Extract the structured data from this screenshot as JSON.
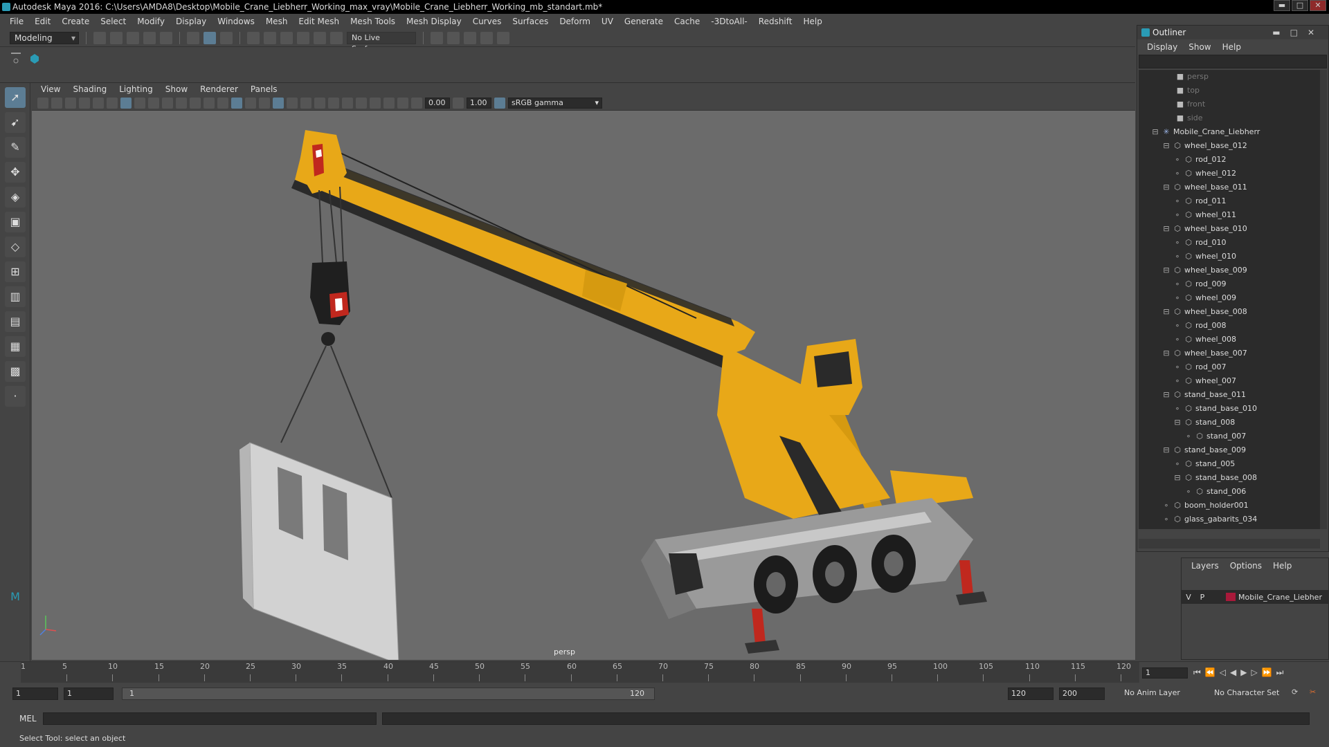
{
  "window": {
    "title": "Autodesk Maya 2016: C:\\Users\\AMDA8\\Desktop\\Mobile_Crane_Liebherr_Working_max_vray\\Mobile_Crane_Liebherr_Working_mb_standart.mb*",
    "min": "▬",
    "max": "□",
    "close": "✕"
  },
  "menu": [
    "File",
    "Edit",
    "Create",
    "Select",
    "Modify",
    "Display",
    "Windows",
    "Mesh",
    "Edit Mesh",
    "Mesh Tools",
    "Mesh Display",
    "Curves",
    "Surfaces",
    "Deform",
    "UV",
    "Generate",
    "Cache",
    "-3DtoAll-",
    "Redshift",
    "Help"
  ],
  "shelf": {
    "mode": "Modeling",
    "live_surface": "No Live Surface"
  },
  "viewport": {
    "menu": [
      "View",
      "Shading",
      "Lighting",
      "Show",
      "Renderer",
      "Panels"
    ],
    "exposure": "0.00",
    "gamma_value": "1.00",
    "color_space": "sRGB gamma",
    "camera_label": "persp"
  },
  "outliner": {
    "title": "Outliner",
    "menu": [
      "Display",
      "Show",
      "Help"
    ],
    "items": [
      {
        "name": "persp",
        "depth": 0,
        "type": "camera"
      },
      {
        "name": "top",
        "depth": 0,
        "type": "camera"
      },
      {
        "name": "front",
        "depth": 0,
        "type": "camera"
      },
      {
        "name": "side",
        "depth": 0,
        "type": "camera"
      },
      {
        "name": "Mobile_Crane_Liebherr",
        "depth": 0,
        "type": "group",
        "expanded": true
      },
      {
        "name": "wheel_base_012",
        "depth": 1,
        "type": "mesh",
        "expanded": true
      },
      {
        "name": "rod_012",
        "depth": 2,
        "type": "mesh"
      },
      {
        "name": "wheel_012",
        "depth": 2,
        "type": "mesh"
      },
      {
        "name": "wheel_base_011",
        "depth": 1,
        "type": "mesh",
        "expanded": true
      },
      {
        "name": "rod_011",
        "depth": 2,
        "type": "mesh"
      },
      {
        "name": "wheel_011",
        "depth": 2,
        "type": "mesh"
      },
      {
        "name": "wheel_base_010",
        "depth": 1,
        "type": "mesh",
        "expanded": true
      },
      {
        "name": "rod_010",
        "depth": 2,
        "type": "mesh"
      },
      {
        "name": "wheel_010",
        "depth": 2,
        "type": "mesh"
      },
      {
        "name": "wheel_base_009",
        "depth": 1,
        "type": "mesh",
        "expanded": true
      },
      {
        "name": "rod_009",
        "depth": 2,
        "type": "mesh"
      },
      {
        "name": "wheel_009",
        "depth": 2,
        "type": "mesh"
      },
      {
        "name": "wheel_base_008",
        "depth": 1,
        "type": "mesh",
        "expanded": true
      },
      {
        "name": "rod_008",
        "depth": 2,
        "type": "mesh"
      },
      {
        "name": "wheel_008",
        "depth": 2,
        "type": "mesh"
      },
      {
        "name": "wheel_base_007",
        "depth": 1,
        "type": "mesh",
        "expanded": true
      },
      {
        "name": "rod_007",
        "depth": 2,
        "type": "mesh"
      },
      {
        "name": "wheel_007",
        "depth": 2,
        "type": "mesh"
      },
      {
        "name": "stand_base_011",
        "depth": 1,
        "type": "mesh",
        "expanded": true
      },
      {
        "name": "stand_base_010",
        "depth": 2,
        "type": "mesh"
      },
      {
        "name": "stand_008",
        "depth": 2,
        "type": "mesh",
        "expanded": true
      },
      {
        "name": "stand_007",
        "depth": 3,
        "type": "mesh"
      },
      {
        "name": "stand_base_009",
        "depth": 1,
        "type": "mesh",
        "expanded": true
      },
      {
        "name": "stand_005",
        "depth": 2,
        "type": "mesh"
      },
      {
        "name": "stand_base_008",
        "depth": 2,
        "type": "mesh",
        "expanded": true
      },
      {
        "name": "stand_006",
        "depth": 3,
        "type": "mesh"
      },
      {
        "name": "boom_holder001",
        "depth": 1,
        "type": "mesh"
      },
      {
        "name": "glass_gabarits_034",
        "depth": 1,
        "type": "mesh"
      }
    ]
  },
  "layers": {
    "menu": [
      "Layers",
      "Options",
      "Help"
    ],
    "row": {
      "v": "V",
      "p": "P",
      "name": "Mobile_Crane_Liebher",
      "color": "#a8193a"
    }
  },
  "timeline": {
    "ticks": [
      "5",
      "10",
      "15",
      "20",
      "25",
      "30",
      "35",
      "40",
      "45",
      "50",
      "55",
      "60",
      "65",
      "70",
      "75",
      "80",
      "85",
      "90",
      "95",
      "100",
      "105",
      "110",
      "115",
      "120"
    ],
    "current_frame": "1",
    "start_mark": "1"
  },
  "range": {
    "start": "1",
    "start2": "1",
    "slider_start": "1",
    "slider_end": "120",
    "end": "120",
    "end2": "200",
    "anim_layer": "No Anim Layer",
    "char_set": "No Character Set"
  },
  "mel": {
    "label": "MEL"
  },
  "help_line": "Select Tool: select an object",
  "colors": {
    "crane_yellow": "#e8a818",
    "boom_dark": "#2a2a2a",
    "viewport_bg": "#6b6b6b",
    "accent": "#5c7d94"
  }
}
